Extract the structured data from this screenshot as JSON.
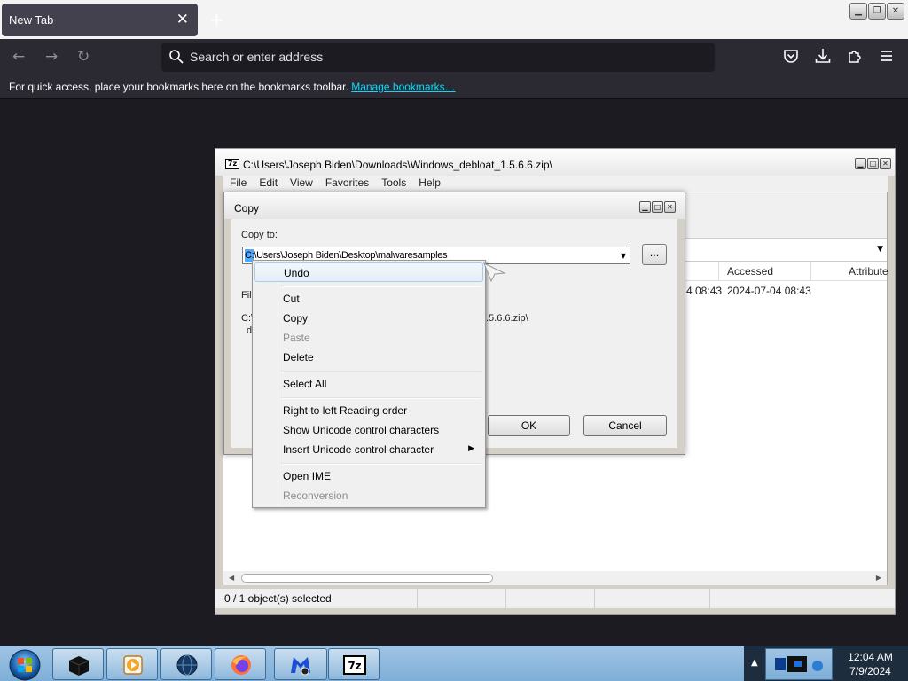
{
  "browser": {
    "tab_title": "New Tab",
    "tab_close": "✕",
    "new_tab": "+",
    "address_placeholder": "Search or enter address",
    "bookmarks_text": "For quick access, place your bookmarks here on the bookmarks toolbar.",
    "manage_bookmarks": "Manage bookmarks…"
  },
  "sevenzip": {
    "title": "C:\\Users\\Joseph Biden\\Downloads\\Windows_debloat_1.5.6.6.zip\\",
    "icon_text": "7z",
    "menu": [
      "File",
      "Edit",
      "View",
      "Favorites",
      "Tools",
      "Help"
    ],
    "columns": {
      "accessed": "Accessed",
      "attributes": "Attribute"
    },
    "row": {
      "modified_tail": "4 08:43",
      "accessed": "2024-07-04 08:43"
    },
    "status": "0 / 1 object(s) selected"
  },
  "copy_dialog": {
    "title": "Copy",
    "copy_to_label": "Copy to:",
    "destination": "C:\\Users\\Joseph Biden\\Desktop\\malwaresamples",
    "browse_label": "...",
    "files_label": "File",
    "files_line1": "C:\\",
    "files_line2": "d",
    "files_tail": ".5.6.6.zip\\",
    "ok_label": "OK",
    "cancel_label": "Cancel"
  },
  "context_menu": {
    "undo": "Undo",
    "cut": "Cut",
    "copy": "Copy",
    "paste": "Paste",
    "delete": "Delete",
    "select_all": "Select All",
    "rtl": "Right to left Reading order",
    "show_unicode": "Show Unicode control characters",
    "insert_unicode": "Insert Unicode control character",
    "open_ime": "Open IME",
    "reconversion": "Reconversion"
  },
  "taskbar": {
    "time": "12:04 AM",
    "date": "7/9/2024",
    "pinned": [
      "cmd",
      "media-player",
      "network-globe",
      "firefox",
      "malwarebytes",
      "7-zip"
    ]
  },
  "colors": {
    "firefox_dark": "#2b2a33",
    "link": "#00ddff",
    "selection": "#3399ff",
    "taskbar": "#8fb9de"
  }
}
